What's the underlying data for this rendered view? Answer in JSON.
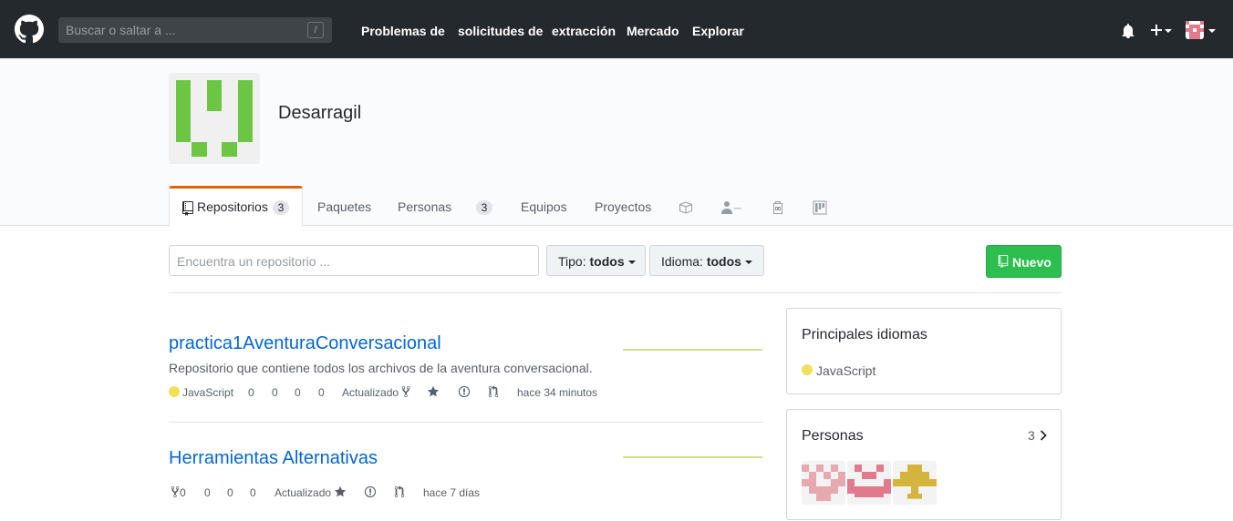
{
  "topbar": {
    "search_placeholder": "Buscar o saltar a ...",
    "slash_key": "/",
    "nav": [
      "Problemas de",
      "solicitudes de",
      "extracción",
      "Mercado",
      "Explorar"
    ]
  },
  "org": {
    "name": "Desarragil"
  },
  "tabs": {
    "repositories": {
      "label": "Repositorios",
      "count": "3"
    },
    "packages": "Paquetes",
    "people": {
      "label": "Personas",
      "count": "3"
    },
    "teams": "Equipos",
    "projects": "Proyectos",
    "icons": [
      "package-icon",
      "person-minus-icon",
      "briefcase-icon",
      "project-board-icon"
    ]
  },
  "filters": {
    "search_placeholder": "Encuentra un repositorio ...",
    "type_label": "Tipo:",
    "type_value": "todos",
    "lang_label": "Idioma:",
    "lang_value": "todos",
    "new_button": "Nuevo"
  },
  "repos": [
    {
      "name": "practica1AventuraConversacional",
      "description": "Repositorio que contiene todos los archivos de la aventura conversacional.",
      "language": "JavaScript",
      "stats": [
        "0",
        "0",
        "0",
        "0"
      ],
      "updated_label": "Actualizado",
      "updated_time": "hace 34 minutos"
    },
    {
      "name": "Herramientas Alternativas",
      "stats": [
        "0",
        "0",
        "0",
        "0"
      ],
      "updated_label": "Actualizado",
      "updated_time": "hace 7 días"
    }
  ],
  "sidebar": {
    "languages": {
      "title": "Principales idiomas",
      "items": [
        "JavaScript"
      ]
    },
    "people": {
      "title": "Personas",
      "count": "3"
    }
  },
  "colors": {
    "topbar": "#24292e",
    "accent_tab": "#e36209",
    "link": "#0366d6",
    "new_button": "#2cbe4e",
    "javascript": "#f1e05a"
  }
}
